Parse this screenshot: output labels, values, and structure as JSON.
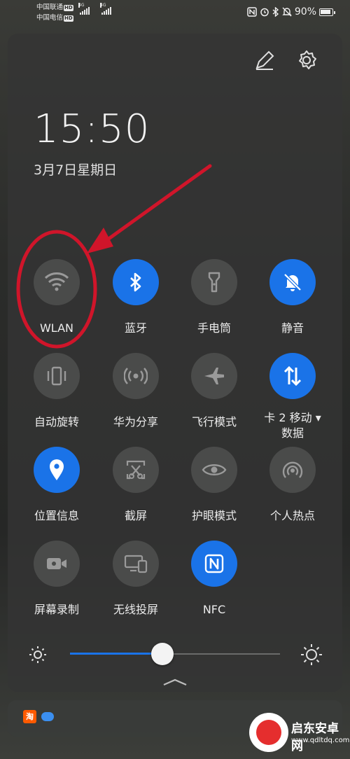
{
  "status_bar": {
    "carrier1": "中国联通",
    "carrier2": "中国电信",
    "hd": "HD",
    "net1": "4G",
    "net2": "4G",
    "battery_text": "90%",
    "icons": [
      "nfc-icon",
      "alarm-icon",
      "bluetooth-icon",
      "mute-icon",
      "battery-icon"
    ]
  },
  "header": {
    "edit_icon": "pencil-icon",
    "settings_icon": "gear-icon",
    "time": "15:50",
    "date": "3月7日星期日"
  },
  "tiles": [
    {
      "label": "WLAN",
      "icon": "wifi-icon",
      "on": false
    },
    {
      "label": "蓝牙",
      "icon": "bluetooth-icon",
      "on": true
    },
    {
      "label": "手电筒",
      "icon": "flashlight-icon",
      "on": false
    },
    {
      "label": "静音",
      "icon": "bell-off-icon",
      "on": true
    },
    {
      "label": "自动旋转",
      "icon": "auto-rotate-icon",
      "on": false
    },
    {
      "label": "华为分享",
      "icon": "share-icon",
      "on": false
    },
    {
      "label": "飞行模式",
      "icon": "airplane-icon",
      "on": false
    },
    {
      "label": "卡 2 移动 ▾",
      "label2": "数据",
      "icon": "mobile-data-icon",
      "on": true
    },
    {
      "label": "位置信息",
      "icon": "location-icon",
      "on": true
    },
    {
      "label": "截屏",
      "icon": "screenshot-icon",
      "on": false
    },
    {
      "label": "护眼模式",
      "icon": "eye-icon",
      "on": false
    },
    {
      "label": "个人热点",
      "icon": "hotspot-icon",
      "on": false
    },
    {
      "label": "屏幕录制",
      "icon": "screen-record-icon",
      "on": false
    },
    {
      "label": "无线投屏",
      "icon": "cast-icon",
      "on": false
    },
    {
      "label": "NFC",
      "icon": "nfc-icon",
      "on": true
    }
  ],
  "brightness": {
    "level": 0.44
  },
  "notification": {
    "app_label": "淘",
    "icons": [
      "taobao-icon",
      "chat-bubble-icon"
    ]
  },
  "watermark": {
    "name": "启东安卓网",
    "url": "www.qdltdq.com"
  },
  "colors": {
    "accent": "#1a73e8",
    "annotation": "#d0152a"
  }
}
